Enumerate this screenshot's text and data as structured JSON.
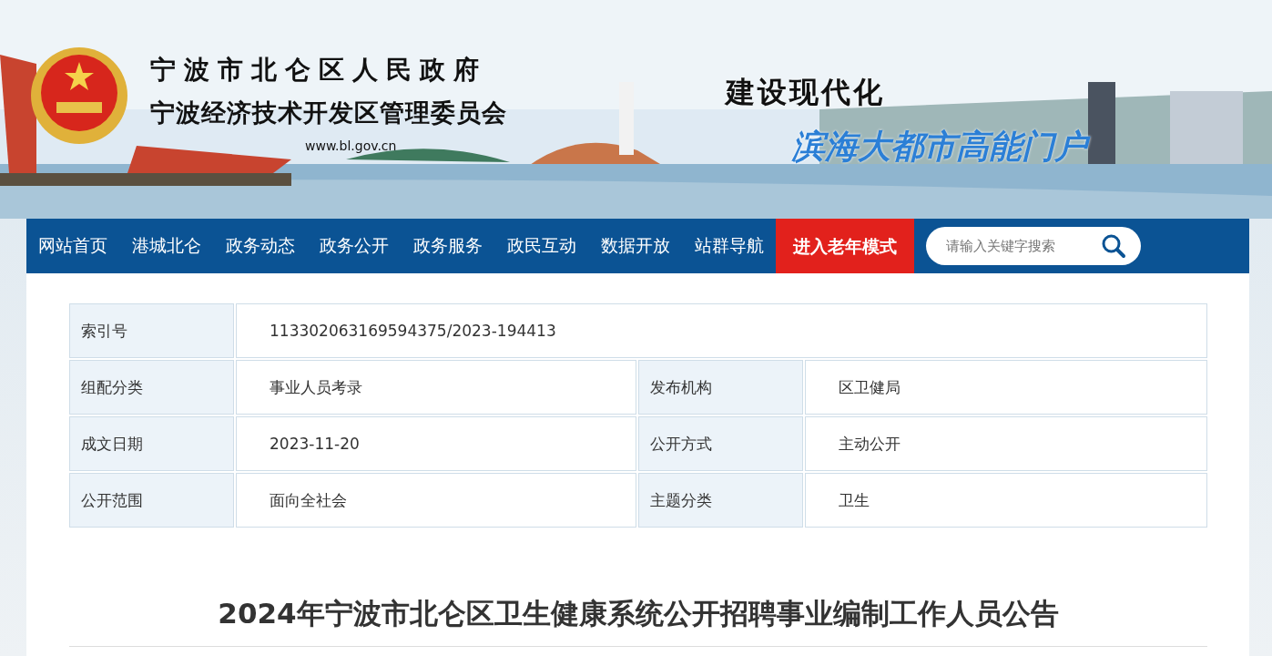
{
  "banner": {
    "title_1": "宁波市北仑区人民政府",
    "title_2": "宁波经济技术开发区管理委员会",
    "url": "www.bl.gov.cn",
    "slogan_1": "建设现代化",
    "slogan_2": "滨海大都市高能门户"
  },
  "nav": {
    "items": [
      {
        "label": "网站首页",
        "kind": "link"
      },
      {
        "label": "港城北仑",
        "kind": "link"
      },
      {
        "label": "政务动态",
        "kind": "link"
      },
      {
        "label": "政务公开",
        "kind": "link"
      },
      {
        "label": "政务服务",
        "kind": "link"
      },
      {
        "label": "政民互动",
        "kind": "link"
      },
      {
        "label": "数据开放",
        "kind": "link"
      },
      {
        "label": "站群导航",
        "kind": "link"
      },
      {
        "label": "进入老年模式",
        "kind": "mode"
      }
    ],
    "search": {
      "placeholder": "请输入关键字搜索"
    }
  },
  "info_table": {
    "rows": [
      {
        "fields": [
          {
            "label": "索引号",
            "value": "113302063169594375/2023-194413"
          }
        ]
      },
      {
        "fields": [
          {
            "label": "组配分类",
            "value": "事业人员考录"
          },
          {
            "label": "发布机构",
            "value": "区卫健局"
          }
        ]
      },
      {
        "fields": [
          {
            "label": "成文日期",
            "value": "2023-11-20"
          },
          {
            "label": "公开方式",
            "value": "主动公开"
          }
        ]
      },
      {
        "fields": [
          {
            "label": "公开范围",
            "value": "面向全社会"
          },
          {
            "label": "主题分类",
            "value": "卫生"
          }
        ]
      }
    ]
  },
  "article": {
    "title": "2024年宁波市北仑区卫生健康系统公开招聘事业编制工作人员公告"
  }
}
